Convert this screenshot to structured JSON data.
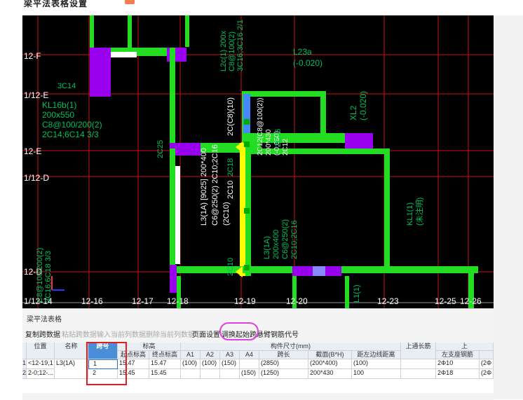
{
  "page": {
    "title": "梁平法表格设置",
    "colors": {
      "beam_green": "#22dd22",
      "beam_yellow": "#ffff00",
      "support_purple": "#9900ee",
      "grid_red": "#cc1111",
      "text_green": "#00cc66",
      "select_blue": "#4a8ed8",
      "annotation_magenta": "#e040e0",
      "annotation_red": "#e02020"
    }
  },
  "cad": {
    "axis_labels_left": [
      "12-F",
      "1/12-E",
      "12-E",
      "1/12-D",
      "12-D"
    ],
    "axis_labels_bottom": [
      "1/12-14",
      "12-16",
      "12-17",
      "12-18",
      "12-19",
      "12-20",
      "12-23",
      "12-25",
      "12-26"
    ],
    "beam_texts": {
      "kl16b": [
        "KL16b(1)",
        "200x550",
        "C8@100/200(2)",
        "2C14;6C14 3/3"
      ],
      "l3_long": [
        "L3(1A) [9025] 200*400",
        "C6@250(2) 2C10;2C16",
        "(2C10)"
      ],
      "l3_short": [
        "L3(1A)",
        "200x400",
        "C6@250(2)",
        "2C10;2C16"
      ],
      "l2c": [
        "L2c(1) 200x",
        "C8@100(2)",
        "3C16;3C16 2/1"
      ],
      "l23a": [
        "L23a",
        "(-0.020)"
      ],
      "xl2": [
        "XL2",
        "(-0.020)"
      ],
      "kl1": [
        "KL1(1)",
        "(未注明)"
      ],
      "l12c": [
        "2C12(C8@100(2))",
        "200*430",
        "(-0.050)",
        "2C12"
      ],
      "misc": [
        "3C14",
        "2C25",
        "2C18",
        "2C16",
        "2C10",
        "2C10",
        "2C(C8)(10)",
        "L1(1)",
        "C8@100/200(2)",
        "3C16;6C18 3/3"
      ]
    }
  },
  "panel": {
    "title": "梁平法表格",
    "toolbar": [
      {
        "label": "复制跨数据",
        "enabled": true
      },
      {
        "label": "粘贴跨数据",
        "enabled": false
      },
      {
        "label": "输入当前列数据",
        "enabled": false
      },
      {
        "label": "删除当前列数据",
        "enabled": false
      },
      {
        "label": "页面设置",
        "enabled": true
      },
      {
        "label": "调换起始跨",
        "enabled": true
      },
      {
        "label": "悬臂钢筋代号",
        "enabled": true
      }
    ],
    "table": {
      "headers": {
        "position": "位置",
        "name": "名称",
        "span": "跨号",
        "elevation_group": "标高",
        "start_elev": "起点标高",
        "end_elev": "终点标高",
        "dims_group": "构件尺寸(mm)",
        "a1": "A1",
        "a2": "A2",
        "a3": "A3",
        "a4": "A4",
        "span_len": "跨长",
        "section": "截面(B*H)",
        "edge_dist": "距左边线距离",
        "top_bar": "上通长筋",
        "right_group": "上",
        "left_support": "左支座钢筋"
      },
      "rows": [
        {
          "pos": "<12-19,1",
          "name": "L3(1A)",
          "span": "1",
          "start": "15.47",
          "end": "15.47",
          "a1": "(100)",
          "a2": "(100)",
          "a3": "(150)",
          "a4": "",
          "len": "(2850)",
          "section": "(200*400)",
          "edge": "(100)",
          "top": "",
          "left": "2Φ10",
          "extra": "(2Φ"
        },
        {
          "pos": "2-0;12-...",
          "name": "",
          "span": "2",
          "start": "15.45",
          "end": "15.45",
          "a1": "",
          "a2": "",
          "a3": "",
          "a4": "(150)",
          "len": "(1250)",
          "section": "200*430",
          "edge": "100",
          "top": "",
          "left": "2Φ18",
          "extra": "(2Φ"
        }
      ],
      "row_markers": [
        "1",
        "2"
      ]
    }
  }
}
